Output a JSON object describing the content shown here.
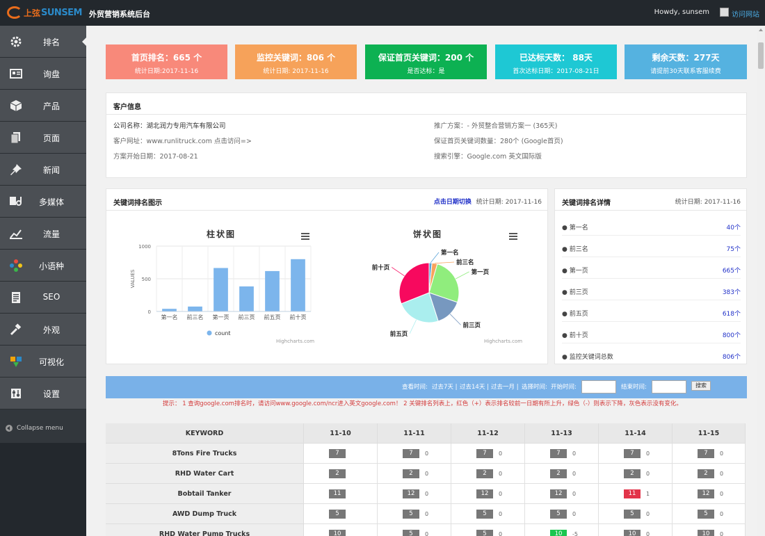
{
  "header": {
    "logo_cn": "上弦",
    "logo_en": "SUNSEM",
    "site_title": "外贸营销系统后台",
    "howdy": "Howdy, sunsem",
    "visit_site": "访问网站"
  },
  "sidebar": {
    "items": [
      {
        "label": "排名",
        "icon": "gear-icon"
      },
      {
        "label": "询盘",
        "icon": "inquiry-icon"
      },
      {
        "label": "产品",
        "icon": "box-icon"
      },
      {
        "label": "页面",
        "icon": "pages-icon"
      },
      {
        "label": "新闻",
        "icon": "pin-icon"
      },
      {
        "label": "多媒体",
        "icon": "media-icon"
      },
      {
        "label": "流量",
        "icon": "traffic-icon"
      },
      {
        "label": "小语种",
        "icon": "language-icon"
      },
      {
        "label": "SEO",
        "icon": "seo-icon"
      },
      {
        "label": "外观",
        "icon": "brush-icon"
      },
      {
        "label": "可视化",
        "icon": "visual-icon"
      },
      {
        "label": "设置",
        "icon": "settings-icon"
      }
    ],
    "collapse": "Collapse menu"
  },
  "stats": [
    {
      "big": "首页排名：665 个",
      "small": "统计日期:2017-11-16",
      "color": "#f8897a"
    },
    {
      "big": "监控关键词：806 个",
      "small": "统计日期: 2017-11-16",
      "color": "#f6a25a"
    },
    {
      "big": "保证首页关键词：200 个",
      "small": "是否达标：是",
      "color": "#0db152"
    },
    {
      "big": "已达标天数： 88天",
      "small": "首次达标日期：2017-08-21日",
      "color": "#1ec8d4"
    },
    {
      "big": "剩余天数：277天",
      "small": "请提前30天联系客服续费",
      "color": "#55b2e0"
    }
  ],
  "customer": {
    "title": "客户信息",
    "company": "公司名称：湖北润力专用汽车有限公司",
    "url": "客户网址：www.runlitruck.com 点击访问=>",
    "start": "方案开始日期：2017-08-21",
    "plan": "推广方案：- 外贸整合营销方案一 (365天)",
    "guarantee": "保证首页关键词数量：280个 (Google首页)",
    "engine": "搜索引擎：Google.com 英文国际版"
  },
  "chart_panel": {
    "title": "关键词排名图示",
    "switch_link": "点击日期切换",
    "date": "统计日期: 2017-11-16",
    "credit": "Highcharts.com"
  },
  "chart_data": [
    {
      "type": "bar",
      "title": "柱状图",
      "categories": [
        "第一名",
        "前三名",
        "第一页",
        "前三页",
        "前五页",
        "前十页"
      ],
      "series": [
        {
          "name": "count",
          "values": [
            40,
            75,
            665,
            383,
            618,
            800
          ]
        }
      ],
      "ylabel": "VALUES",
      "ylim": [
        0,
        1000
      ],
      "yticks": [
        "1000",
        "500",
        "0"
      ],
      "color": "#7cb5ec",
      "grid": true,
      "legend": "bottom"
    },
    {
      "type": "pie",
      "title": "饼状图",
      "categories": [
        "第一名",
        "前三名",
        "第一页",
        "前三页",
        "前五页",
        "前十页"
      ],
      "values": [
        40,
        75,
        665,
        383,
        618,
        800
      ],
      "colors": [
        "#5ba4d8",
        "#f7a35c",
        "#90ed7d",
        "#7798bf",
        "#aaeeee",
        "#f7095e"
      ]
    }
  ],
  "details": {
    "title": "关键词排名详情",
    "date": "统计日期: 2017-11-16",
    "rows": [
      {
        "label": "● 第一名",
        "value": "40个"
      },
      {
        "label": "● 前三名",
        "value": "75个"
      },
      {
        "label": "● 第一页",
        "value": "665个"
      },
      {
        "label": "● 前三页",
        "value": "383个"
      },
      {
        "label": "● 前五页",
        "value": "618个"
      },
      {
        "label": "● 前十页",
        "value": "800个"
      },
      {
        "label": "● 监控关键词总数",
        "value": "806个"
      }
    ]
  },
  "filter": {
    "view_time": "查看时间:",
    "past7": "过去7天 |",
    "past14": "过去14天 |",
    "past_month": "过去一月 |",
    "select_time": "选择时间:",
    "start_label": "开始时间:",
    "end_label": "结束时间:",
    "search_button": "搜索",
    "tip": "提示： 1 查询google.com排名时，请访问www.google.com/ncr进入英文google.com！  2 关键排名列表上，红色（+）表示排名较前一日期有所上升，绿色（-）则表示下降，灰色表示没有变化。"
  },
  "table": {
    "headers": [
      "KEYWORD",
      "11-10",
      "11-11",
      "11-12",
      "11-13",
      "11-14",
      "11-15"
    ],
    "rows": [
      {
        "keyword": "8Tons Fire Trucks",
        "cells": [
          {
            "r": "7",
            "c": ""
          },
          {
            "r": "7",
            "c": "0"
          },
          {
            "r": "7",
            "c": "0"
          },
          {
            "r": "7",
            "c": "0"
          },
          {
            "r": "7",
            "c": "0"
          },
          {
            "r": "7",
            "c": "0"
          }
        ]
      },
      {
        "keyword": "RHD Water Cart",
        "cells": [
          {
            "r": "2",
            "c": ""
          },
          {
            "r": "2",
            "c": "0"
          },
          {
            "r": "2",
            "c": "0"
          },
          {
            "r": "2",
            "c": "0"
          },
          {
            "r": "2",
            "c": "0"
          },
          {
            "r": "2",
            "c": "0"
          }
        ]
      },
      {
        "keyword": "Bobtail Tanker",
        "cells": [
          {
            "r": "11",
            "c": ""
          },
          {
            "r": "12",
            "c": "0"
          },
          {
            "r": "12",
            "c": "0"
          },
          {
            "r": "12",
            "c": "0"
          },
          {
            "r": "11",
            "c": "1",
            "s": "red"
          },
          {
            "r": "12",
            "c": "0"
          }
        ]
      },
      {
        "keyword": "AWD Dump Truck",
        "cells": [
          {
            "r": "5",
            "c": ""
          },
          {
            "r": "5",
            "c": "0"
          },
          {
            "r": "5",
            "c": "0"
          },
          {
            "r": "5",
            "c": "0"
          },
          {
            "r": "5",
            "c": "0"
          },
          {
            "r": "5",
            "c": "0"
          }
        ]
      },
      {
        "keyword": "RHD Water Pump Trucks",
        "cells": [
          {
            "r": "10",
            "c": ""
          },
          {
            "r": "5",
            "c": "0"
          },
          {
            "r": "5",
            "c": "0"
          },
          {
            "r": "10",
            "c": "-5",
            "s": "green"
          },
          {
            "r": "10",
            "c": "0"
          },
          {
            "r": "10",
            "c": "0"
          }
        ]
      }
    ]
  }
}
